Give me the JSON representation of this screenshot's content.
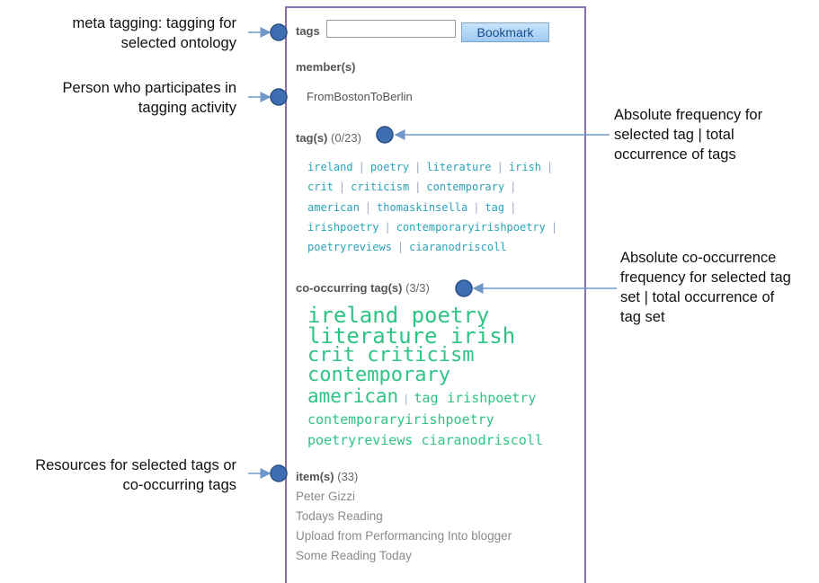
{
  "annotations": {
    "meta": [
      "meta tagging: tagging for",
      "selected ontology"
    ],
    "person": [
      "Person who participates in",
      "tagging activity"
    ],
    "absfreq": [
      "Absolute frequency for",
      "selected tag | total",
      "occurrence of tags"
    ],
    "cooc": [
      "Absolute co-occurrence",
      "frequency for selected tag",
      "set | total occurrence of",
      "tag set"
    ],
    "resources": [
      "Resources for selected tags or",
      "co-occurring tags"
    ]
  },
  "widget": {
    "tags_label": "tags",
    "tags_input_value": "",
    "bookmark_label": "Bookmark",
    "members_label": "member(s)",
    "member_name": "FromBostonToBerlin",
    "tags_section_label": "tag(s)",
    "tags_count": "(0/23)",
    "tags": [
      "ireland",
      "poetry",
      "literature",
      "irish",
      "crit",
      "criticism",
      "contemporary",
      "american",
      "thomaskinsella",
      "tag",
      "irishpoetry",
      "contemporaryirishpoetry",
      "poetryreviews",
      "ciaranodriscoll"
    ],
    "cooc_label": "co-occurring tag(s)",
    "cooc_count": "(3/3)",
    "cooc_tags": {
      "ireland": "ireland",
      "poetry": "poetry",
      "literature": "literature",
      "irish": "irish",
      "crit": "crit",
      "criticism": "criticism",
      "contemporary": "contemporary",
      "american": "american",
      "tag": "tag",
      "irishpoetry": "irishpoetry",
      "contemporaryirishpoetry": "contemporaryirishpoetry",
      "poetryreviews": "poetryreviews",
      "ciaranodriscoll": "ciaranodriscoll"
    },
    "items_label": "item(s)",
    "items_count": "(33)",
    "items": [
      "Peter Gizzi",
      "Todays Reading",
      "Upload from Performancing Into blogger",
      "Some Reading Today"
    ]
  },
  "colors": {
    "panel_border": "#8a6fb0",
    "marker": "#3d6fb2",
    "tag_cloud": "#2aa3b9",
    "cooc_cloud": "#2fc486",
    "arrow": "#6f98c9"
  }
}
